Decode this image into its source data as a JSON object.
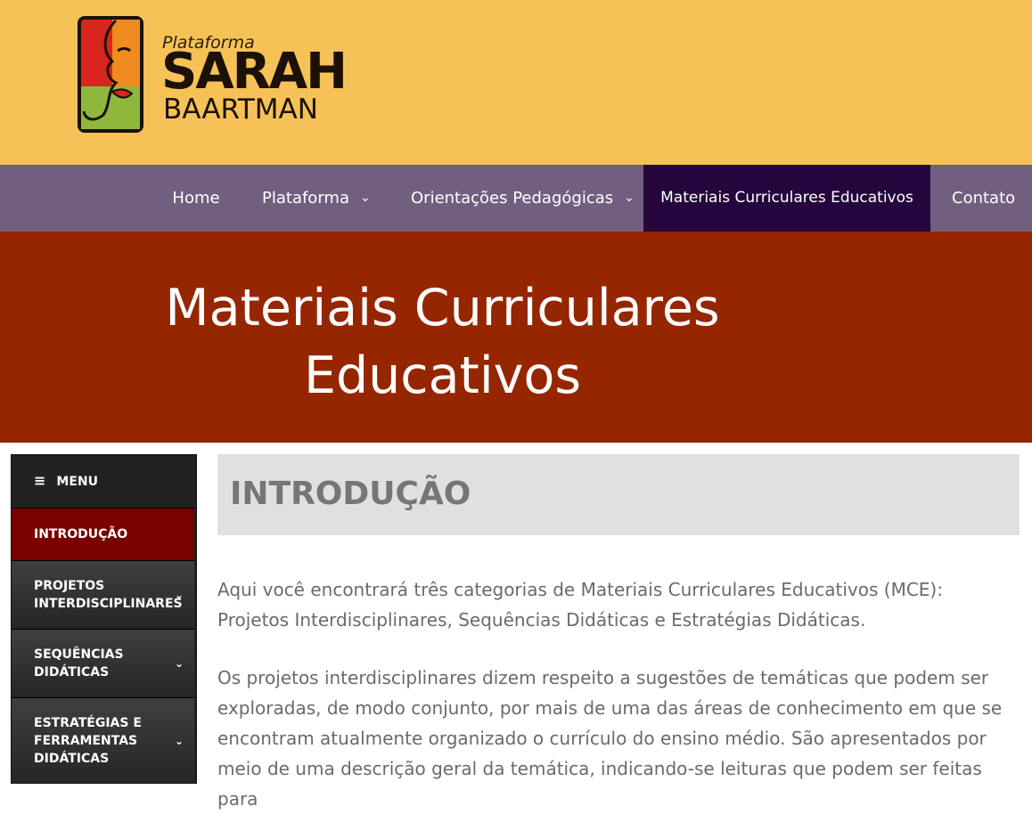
{
  "logo": {
    "small": "Plataforma",
    "big": "SARAH",
    "mid": "BAARTMAN",
    "colors": {
      "red": "#d9261c",
      "orange": "#f08b1d",
      "green": "#8db83c"
    }
  },
  "nav": {
    "items": [
      {
        "label": "Home",
        "dropdown": false
      },
      {
        "label": "Plataforma",
        "dropdown": true
      },
      {
        "label": "Orientações Pedagógicas",
        "dropdown": true
      },
      {
        "label": "Materiais Curriculares Educativos",
        "dropdown": false,
        "active": true
      },
      {
        "label": "Contato",
        "dropdown": false
      }
    ]
  },
  "hero": {
    "title": "Materiais Curriculares Educativos"
  },
  "sidebar": {
    "menu_label": "MENU",
    "items": [
      {
        "label": "INTRODUÇÃO",
        "active": true
      },
      {
        "label": "PROJETOS INTERDISCIPLINARES",
        "expandable": true
      },
      {
        "label": "SEQUÊNCIAS DIDÁTICAS",
        "expandable": true
      },
      {
        "label": "ESTRATÉGIAS E FERRAMENTAS DIDÁTICAS",
        "expandable": true
      }
    ]
  },
  "content": {
    "title": "INTRODUÇÃO",
    "paragraphs": [
      "Aqui você encontrará três categorias de Materiais Curriculares Educativos (MCE): Projetos Interdisciplinares, Sequências Didáticas e Estratégias Didáticas.",
      "Os projetos interdisciplinares dizem respeito a sugestões de temáticas que podem ser exploradas, de modo conjunto, por mais de uma das áreas de conhecimento em que se encontram atualmente organizado o currículo do ensino médio. São apresentados por meio de uma descrição geral da temática, indicando-se leituras que podem ser feitas para"
    ]
  },
  "colors": {
    "header_bg": "#f6c257",
    "nav_bg": "#725f80",
    "nav_active_bg": "#25073d",
    "hero_bg": "#952600",
    "sidebar_active": "#7b0000"
  }
}
